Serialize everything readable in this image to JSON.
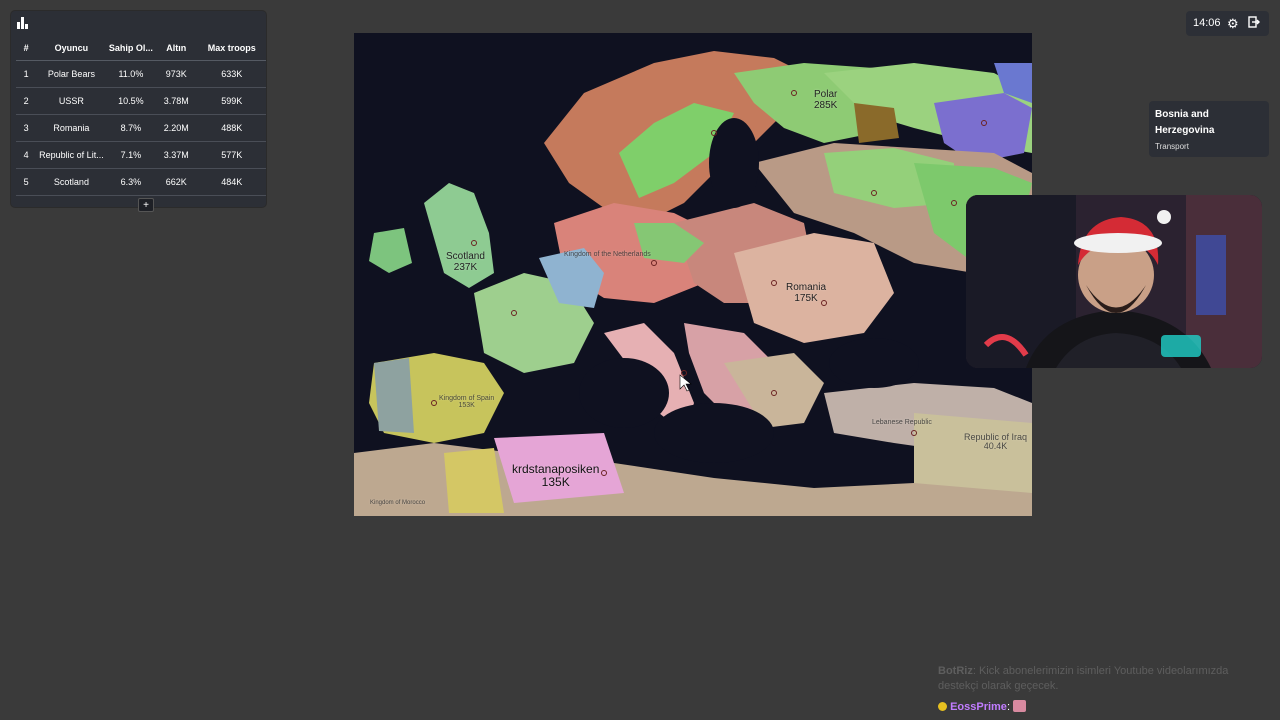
{
  "leaderboard": {
    "icon": "bar-chart-icon",
    "headers": [
      "#",
      "Oyuncu",
      "Sahip Ol...",
      "Altın",
      "Max troops"
    ],
    "rows": [
      {
        "rank": "1",
        "player": "Polar Bears",
        "owned": "11.0%",
        "gold": "973K",
        "troops": "633K"
      },
      {
        "rank": "2",
        "player": "USSR",
        "owned": "10.5%",
        "gold": "3.78M",
        "troops": "599K"
      },
      {
        "rank": "3",
        "player": "Romania",
        "owned": "8.7%",
        "gold": "2.20M",
        "troops": "488K"
      },
      {
        "rank": "4",
        "player": "Republic of Lit...",
        "owned": "7.1%",
        "gold": "3.37M",
        "troops": "577K"
      },
      {
        "rank": "5",
        "player": "Scotland",
        "owned": "6.3%",
        "gold": "662K",
        "troops": "484K"
      }
    ],
    "expand_label": "+"
  },
  "topbar": {
    "time": "14:06",
    "settings_icon": "gear-icon",
    "exit_icon": "exit-icon"
  },
  "hover": {
    "title": "Bosnia and Herzegovina",
    "subtitle": "Transport"
  },
  "map": {
    "labels": [
      {
        "name": "Scotland",
        "troops": "237K"
      },
      {
        "name": "Romania",
        "troops": "175K"
      },
      {
        "name": "krdstanaposiken",
        "troops": "135K"
      },
      {
        "name": "Polar",
        "troops": "285K"
      },
      {
        "name": "Republic of Iraq",
        "troops": "40.4K"
      },
      {
        "name": "Lebanese Republic",
        "troops": ""
      },
      {
        "name": "Kingdom of the Netherlands",
        "troops": ""
      },
      {
        "name": "Kingdom of Morocco",
        "troops": ""
      },
      {
        "name": "Kingdom of Spain",
        "troops": "153K"
      }
    ]
  },
  "chat": {
    "faded_user": "BotRiz",
    "faded_message": "Kick abonelerimizin isimleri Youtube videolarımızda destekçi olarak geçecek.",
    "user": "EossPrime",
    "separator": ":"
  }
}
